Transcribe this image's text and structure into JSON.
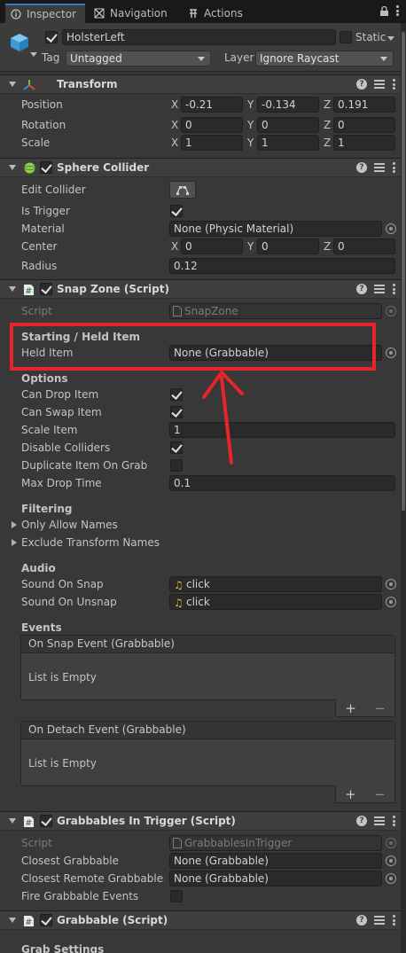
{
  "tabs": [
    {
      "label": "Inspector",
      "icon": "info-icon"
    },
    {
      "label": "Navigation",
      "icon": "navigation-icon"
    },
    {
      "label": "Actions",
      "icon": "actions-icon"
    }
  ],
  "header": {
    "object_name": "HolsterLeft",
    "active": true,
    "static_label": "Static",
    "static": false,
    "tag_label": "Tag",
    "tag_value": "Untagged",
    "layer_label": "Layer",
    "layer_value": "Ignore Raycast"
  },
  "transform": {
    "title": "Transform",
    "rows": [
      {
        "label": "Position",
        "x": "-0.21",
        "y": "-0.134",
        "z": "0.191"
      },
      {
        "label": "Rotation",
        "x": "0",
        "y": "0",
        "z": "0"
      },
      {
        "label": "Scale",
        "x": "1",
        "y": "1",
        "z": "1"
      }
    ],
    "axis": {
      "x": "X",
      "y": "Y",
      "z": "Z"
    }
  },
  "sphere_collider": {
    "title": "Sphere Collider",
    "edit_collider": "Edit Collider",
    "is_trigger": "Is Trigger",
    "material": "Material",
    "material_value": "None (Physic Material)",
    "center": "Center",
    "center_x": "0",
    "center_y": "0",
    "center_z": "0",
    "radius": "Radius",
    "radius_value": "0.12"
  },
  "snap_zone": {
    "title": "Snap Zone (Script)",
    "script_label": "Script",
    "script_value": "SnapZone",
    "section_starting": "Starting / Held Item",
    "held_item": "Held Item",
    "held_item_value": "None (Grabbable)",
    "section_options": "Options",
    "options": [
      {
        "label": "Can Drop Item",
        "type": "check",
        "value": true
      },
      {
        "label": "Can Swap Item",
        "type": "check",
        "value": true
      },
      {
        "label": "Scale Item",
        "type": "text",
        "value": "1"
      },
      {
        "label": "Disable Colliders",
        "type": "check",
        "value": true
      },
      {
        "label": "Duplicate Item On Grab",
        "type": "check",
        "value": false
      },
      {
        "label": "Max Drop Time",
        "type": "text",
        "value": "0.1"
      }
    ],
    "section_filtering": "Filtering",
    "only_allow_names": "Only Allow Names",
    "exclude_transform_names": "Exclude Transform Names",
    "section_audio": "Audio",
    "sound_on_snap": "Sound On Snap",
    "sound_on_snap_value": "click",
    "sound_on_unsnap": "Sound On Unsnap",
    "sound_on_unsnap_value": "click",
    "section_events": "Events",
    "on_snap_event": "On Snap Event (Grabbable)",
    "on_detach_event": "On Detach Event (Grabbable)",
    "list_empty": "List is Empty",
    "plus": "+",
    "minus": "−"
  },
  "grabbables_in_trigger": {
    "title": "Grabbables In Trigger (Script)",
    "script_label": "Script",
    "script_value": "GrabbablesInTrigger",
    "closest_grabbable": "Closest Grabbable",
    "closest_grabbable_value": "None (Grabbable)",
    "closest_remote_grabbable": "Closest Remote Grabbable",
    "closest_remote_grabbable_value": "None (Grabbable)",
    "fire_grabbable_events": "Fire Grabbable Events"
  },
  "grabbable": {
    "title": "Grabbable (Script)",
    "grab_settings": "Grab Settings"
  },
  "colors": {
    "highlight_box": "#e8232a",
    "arrow": "#e8232a",
    "panel_bg": "#383838",
    "accent_tab": "#3a79bb"
  }
}
